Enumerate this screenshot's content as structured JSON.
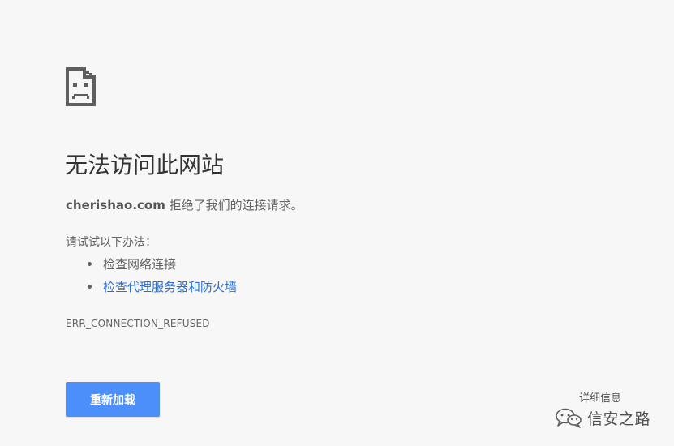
{
  "page": {
    "title": "无法访问此网站",
    "host": "cherishao.com",
    "message_rest": " 拒绝了我们的连接请求。",
    "suggest_heading": "请试试以下办法：",
    "suggestions": [
      {
        "label": "检查网络连接",
        "is_link": false
      },
      {
        "label": "检查代理服务器和防火墙",
        "is_link": true
      }
    ],
    "error_code": "ERR_CONNECTION_REFUSED",
    "reload_label": "重新加载",
    "details_label": "详细信息"
  },
  "watermark": {
    "text": "信安之路",
    "icon": "wechat-icon"
  },
  "colors": {
    "background": "#f7f7f7",
    "button": "#4c8efa",
    "link": "#2a6fd6"
  }
}
